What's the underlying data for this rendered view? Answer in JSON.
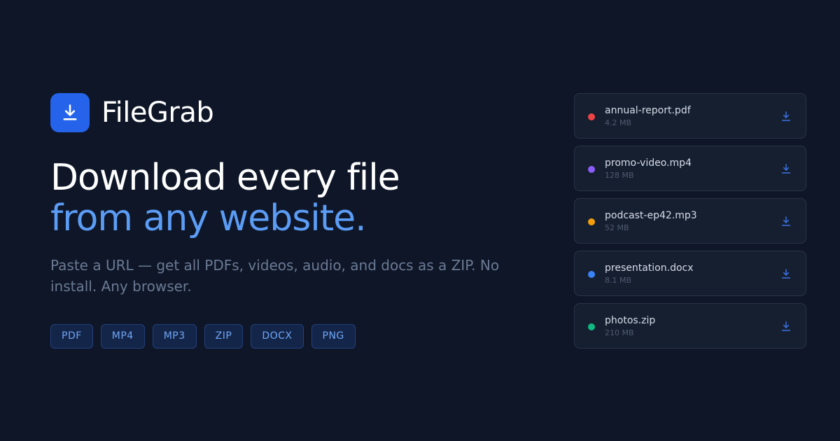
{
  "brand": {
    "name": "FileGrab",
    "logo_icon": "download-icon",
    "logo_color": "#2563eb"
  },
  "hero": {
    "headline_line1": "Download every file",
    "headline_line2": "from any website.",
    "subtitle": "Paste a URL — get all PDFs, videos, audio, and docs as a ZIP.  No install. Any browser."
  },
  "formats": [
    "PDF",
    "MP4",
    "MP3",
    "ZIP",
    "DOCX",
    "PNG"
  ],
  "files": [
    {
      "name": "annual-report.pdf",
      "size": "4.2 MB",
      "color": "#ef4444",
      "action_icon": "download-icon"
    },
    {
      "name": "promo-video.mp4",
      "size": "128 MB",
      "color": "#8b5cf6",
      "action_icon": "download-icon"
    },
    {
      "name": "podcast-ep42.mp3",
      "size": "52 MB",
      "color": "#f59e0b",
      "action_icon": "download-icon"
    },
    {
      "name": "presentation.docx",
      "size": "8.1 MB",
      "color": "#3b82f6",
      "action_icon": "download-icon"
    },
    {
      "name": "photos.zip",
      "size": "210 MB",
      "color": "#10b981",
      "action_icon": "download-icon"
    }
  ],
  "colors": {
    "background": "#0e1628",
    "accent": "#5b9cf5",
    "download_icon": "#3b74e6"
  }
}
